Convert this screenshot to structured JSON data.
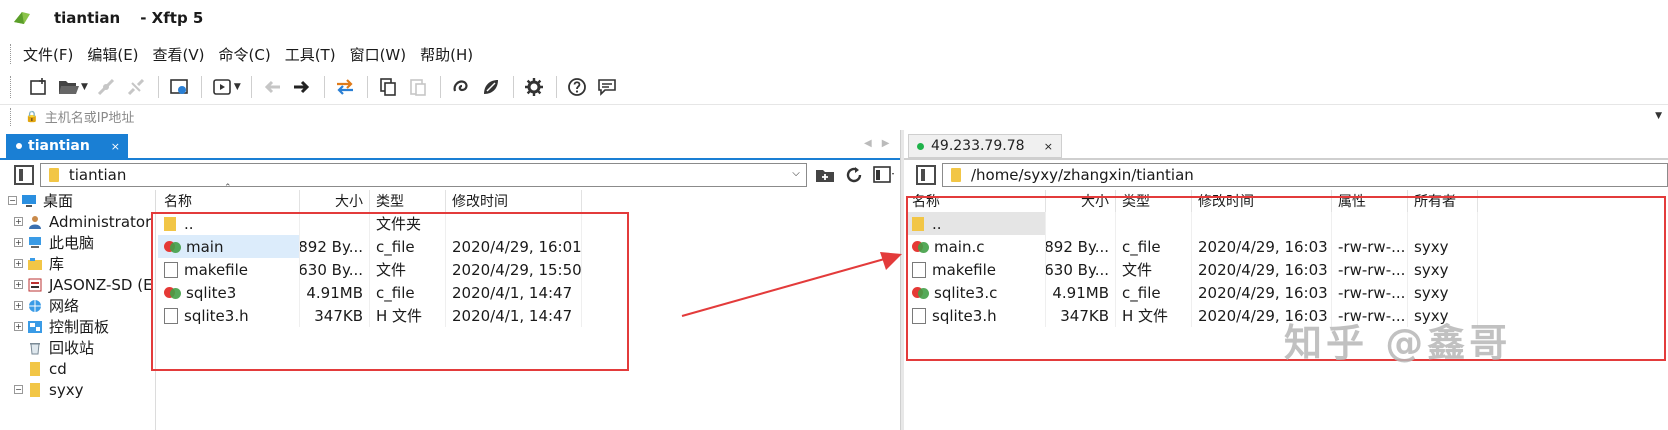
{
  "window": {
    "title": "tiantian",
    "app_name": "- Xftp 5"
  },
  "menu": [
    "文件(F)",
    "编辑(E)",
    "查看(V)",
    "命令(C)",
    "工具(T)",
    "窗口(W)",
    "帮助(H)"
  ],
  "address": {
    "placeholder": "主机名或IP地址"
  },
  "tabs": {
    "local": {
      "label": "tiantian",
      "close": "×"
    },
    "remote": {
      "label": "49.233.79.78",
      "close": "×"
    }
  },
  "local": {
    "path": "tiantian",
    "tree": [
      {
        "label": "桌面",
        "expander": "−",
        "icon": "desktop-icon"
      },
      {
        "label": "Administrator",
        "expander": "+",
        "icon": "user-icon"
      },
      {
        "label": "此电脑",
        "expander": "+",
        "icon": "computer-icon"
      },
      {
        "label": "库",
        "expander": "+",
        "icon": "library-icon"
      },
      {
        "label": "JASONZ-SD (E",
        "expander": "+",
        "icon": "sd-card-icon"
      },
      {
        "label": "网络",
        "expander": "+",
        "icon": "network-icon"
      },
      {
        "label": "控制面板",
        "expander": "+",
        "icon": "control-panel-icon"
      },
      {
        "label": "回收站",
        "expander": "",
        "icon": "recycle-bin-icon"
      },
      {
        "label": "cd",
        "expander": "",
        "icon": "folder-icon"
      },
      {
        "label": "syxy",
        "expander": "−",
        "icon": "folder-icon"
      }
    ],
    "columns": {
      "name": "名称",
      "size": "大小",
      "type": "类型",
      "modified": "修改时间"
    },
    "rows": [
      {
        "name": "..",
        "size": "",
        "type": "文件夹",
        "modified": "",
        "icon": "folder"
      },
      {
        "name": "main",
        "size": "892 By...",
        "type": "c_file",
        "modified": "2020/4/29, 16:01",
        "icon": "exe"
      },
      {
        "name": "makefile",
        "size": "630 By...",
        "type": "文件",
        "modified": "2020/4/29, 15:50",
        "icon": "file"
      },
      {
        "name": "sqlite3",
        "size": "4.91MB",
        "type": "c_file",
        "modified": "2020/4/1, 14:47",
        "icon": "exe"
      },
      {
        "name": "sqlite3.h",
        "size": "347KB",
        "type": "H 文件",
        "modified": "2020/4/1, 14:47",
        "icon": "file"
      }
    ]
  },
  "remote": {
    "path": "/home/syxy/zhangxin/tiantian",
    "columns": {
      "name": "名称",
      "size": "大小",
      "type": "类型",
      "modified": "修改时间",
      "attr": "属性",
      "owner": "所有者"
    },
    "rows": [
      {
        "name": "..",
        "size": "",
        "type": "",
        "modified": "",
        "attr": "",
        "owner": "",
        "icon": "folder"
      },
      {
        "name": "main.c",
        "size": "892 By...",
        "type": "c_file",
        "modified": "2020/4/29, 16:03",
        "attr": "-rw-rw-...",
        "owner": "syxy",
        "icon": "exe"
      },
      {
        "name": "makefile",
        "size": "630 By...",
        "type": "文件",
        "modified": "2020/4/29, 16:03",
        "attr": "-rw-rw-...",
        "owner": "syxy",
        "icon": "file"
      },
      {
        "name": "sqlite3.c",
        "size": "4.91MB",
        "type": "c_file",
        "modified": "2020/4/29, 16:03",
        "attr": "-rw-rw-...",
        "owner": "syxy",
        "icon": "exe"
      },
      {
        "name": "sqlite3.h",
        "size": "347KB",
        "type": "H 文件",
        "modified": "2020/4/29, 16:03",
        "attr": "-rw-rw-...",
        "owner": "syxy",
        "icon": "file"
      }
    ]
  },
  "watermark": "知乎 @鑫哥",
  "colors": {
    "accent": "#1a7fd4",
    "annotation": "#e33b3b",
    "connected": "#1fb24a"
  }
}
